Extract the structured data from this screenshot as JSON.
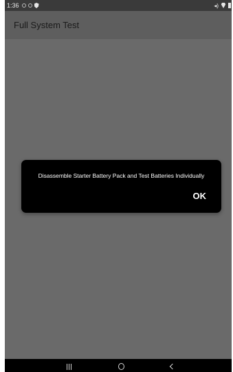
{
  "status_bar": {
    "time": "1:36",
    "icons_left": [
      "notification-ring-icon",
      "notification-ring-icon",
      "shield-icon"
    ],
    "icons_right": [
      "mute-icon",
      "location-pin-icon",
      "battery-icon"
    ],
    "mute_glyph": "◂)"
  },
  "app_bar": {
    "title": "Full System Test"
  },
  "dialog": {
    "message": "Disassemble Starter Battery Pack and Test Batteries Individually",
    "ok_label": "OK"
  },
  "nav_bar": {
    "buttons": [
      "recents-icon",
      "home-icon",
      "back-icon"
    ]
  },
  "colors": {
    "scrim": "#6a6a6a",
    "app_bar": "#5e5e5e",
    "dialog_bg": "#000000",
    "status_bar": "#3a3a3a",
    "nav_bar": "#000000"
  }
}
